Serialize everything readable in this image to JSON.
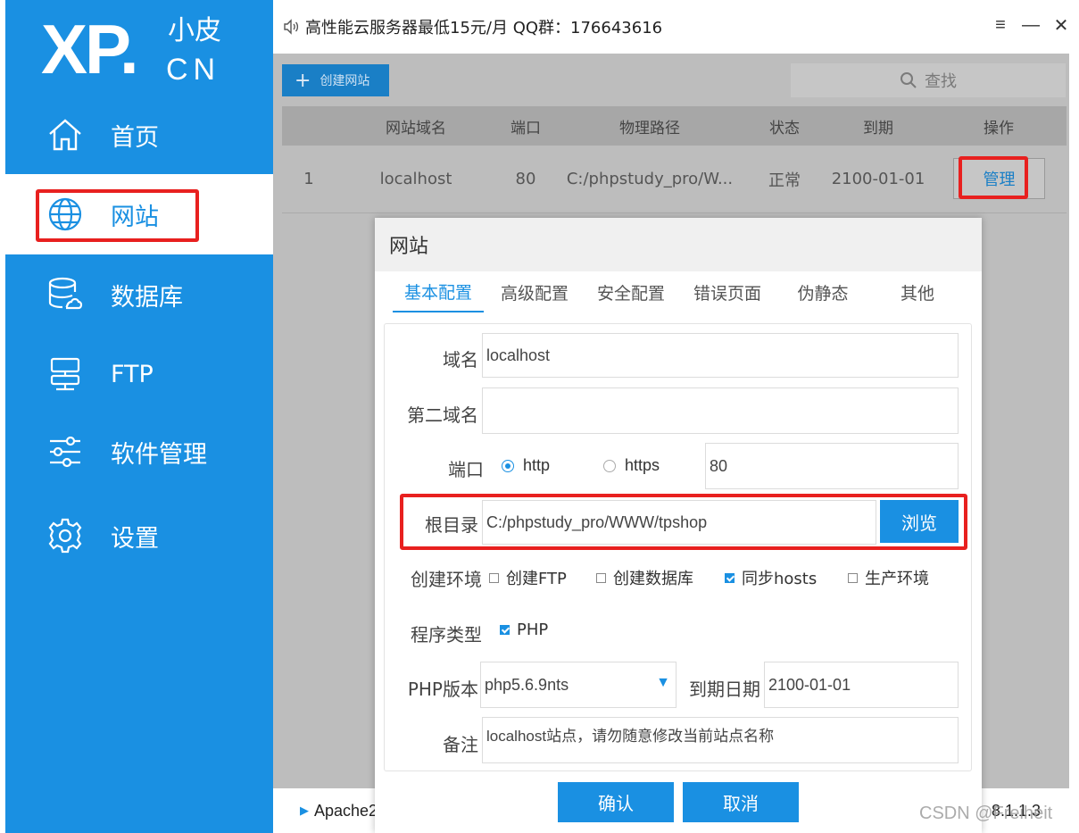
{
  "logo": {
    "main": "XP.",
    "zh": "小皮",
    "cn": "CN"
  },
  "sidebar": {
    "items": [
      {
        "label": "首页",
        "icon": "home-icon"
      },
      {
        "label": "网站",
        "icon": "globe-icon",
        "active": true
      },
      {
        "label": "数据库",
        "icon": "database-icon"
      },
      {
        "label": "FTP",
        "icon": "ftp-server-icon"
      },
      {
        "label": "软件管理",
        "icon": "sliders-icon"
      },
      {
        "label": "设置",
        "icon": "gear-icon"
      }
    ]
  },
  "titlebar": {
    "announcement": "高性能云服务器最低15元/月  QQ群：176643616",
    "controls": [
      "menu-icon",
      "minimize-icon",
      "close-icon"
    ]
  },
  "toolbar": {
    "create_label": "创建网站",
    "search_placeholder": "查找"
  },
  "table": {
    "headers": [
      "网站域名",
      "端口",
      "物理路径",
      "状态",
      "到期",
      "操作"
    ],
    "rows": [
      {
        "index": "1",
        "domain": "localhost",
        "port": "80",
        "path": "C:/phpstudy_pro/W...",
        "status": "正常",
        "expires": "2100-01-01",
        "action": "管理"
      }
    ]
  },
  "dialog": {
    "title": "网站",
    "tabs": [
      "基本配置",
      "高级配置",
      "安全配置",
      "错误页面",
      "伪静态",
      "其他"
    ],
    "fields": {
      "domain_label": "域名",
      "domain_value": "localhost",
      "second_domain_label": "第二域名",
      "second_domain_value": "",
      "port_label": "端口",
      "http_label": "http",
      "https_label": "https",
      "port_value": "80",
      "root_label": "根目录",
      "root_value": "C:/phpstudy_pro/WWW/tpshop",
      "browse_label": "浏览",
      "env_label": "创建环境",
      "env_options": [
        {
          "label": "创建FTP",
          "checked": false
        },
        {
          "label": "创建数据库",
          "checked": false
        },
        {
          "label": "同步hosts",
          "checked": true
        },
        {
          "label": "生产环境",
          "checked": false
        }
      ],
      "program_label": "程序类型",
      "program_php": "PHP",
      "php_version_label": "PHP版本",
      "php_version_value": "php5.6.9nts",
      "expire_label": "到期日期",
      "expire_value": "2100-01-01",
      "note_label": "备注",
      "note_value": "localhost站点，请勿随意修改当前站点名称"
    },
    "confirm_label": "确认",
    "cancel_label": "取消"
  },
  "status_bar": {
    "service": "Apache2",
    "version": "8.1.1.3"
  },
  "watermark": "CSDN @Freiheit",
  "colors": {
    "accent": "#1a90e2",
    "highlight": "#e8201f"
  }
}
